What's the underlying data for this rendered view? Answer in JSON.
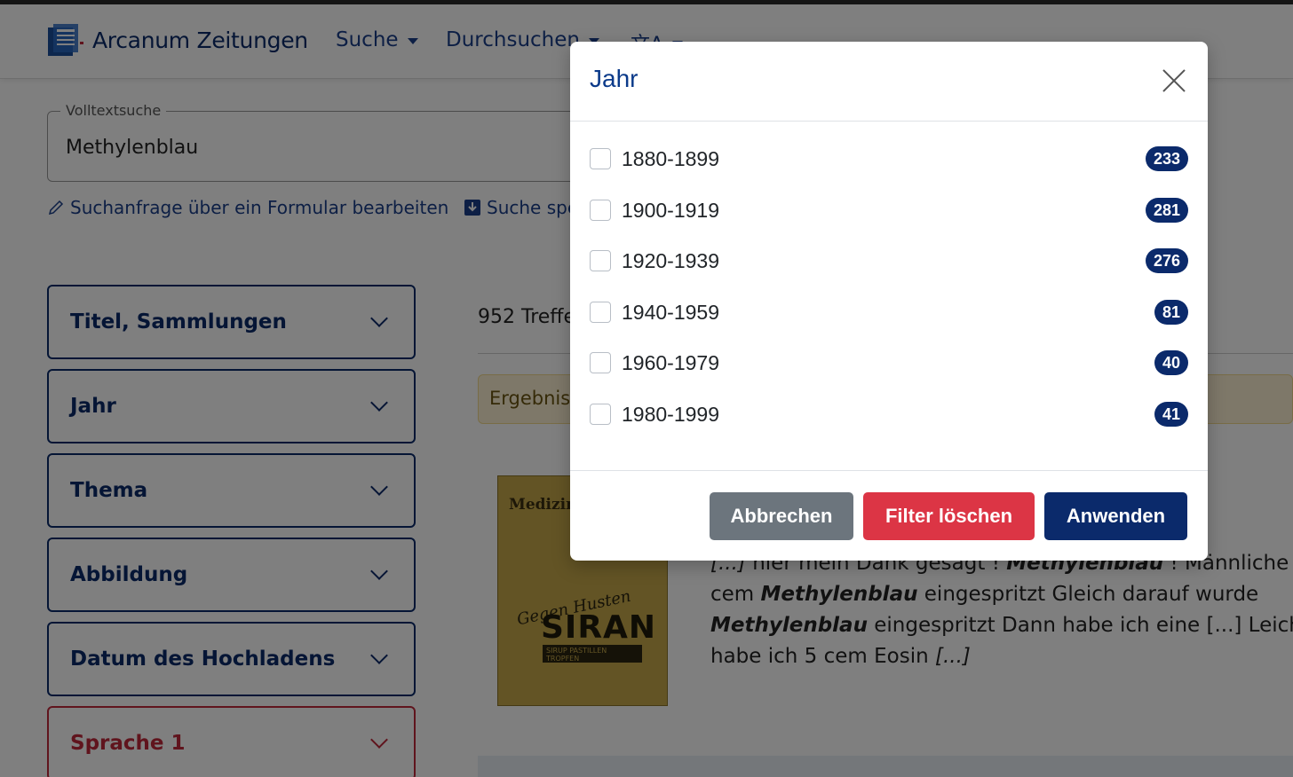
{
  "app": {
    "brand_prefix": "Arcanum",
    "brand_suffix": " Zeitungen"
  },
  "nav": {
    "search": "Suche",
    "browse": "Durchsuchen",
    "language_icon": "translate-icon"
  },
  "search": {
    "legend": "Volltextsuche",
    "value": "Methylenblau"
  },
  "links": {
    "edit_form": "Suchanfrage über ein Formular bearbeiten",
    "save_search": "Suche spe"
  },
  "facets": [
    {
      "label": "Titel, Sammlungen"
    },
    {
      "label": "Jahr"
    },
    {
      "label": "Thema"
    },
    {
      "label": "Abbildung"
    },
    {
      "label": "Datum des Hochladens"
    },
    {
      "label": "Sprache 1"
    }
  ],
  "results": {
    "hits": "952 Treffe",
    "note": "Ergebniss",
    "thumb_title": "Medizinisch",
    "thumb_script": "Gegen Husten",
    "thumb_brand": "SIRAN",
    "thumb_strip": "SIRUP PASTILLEN TROPFEN",
    "snippet": [
      {
        "pre": "[...] ",
        "mid": "hier mein Dank gesagt ! ",
        "bold": "Methylenblau",
        "post": " ! Männliche Le"
      },
      {
        "pre": "",
        "mid": "cem  ",
        "bold": "Methylenblau",
        "post": "  eingespritzt  Gleich  darauf  wurde"
      },
      {
        "pre": "",
        "mid": "",
        "bold": "Methylenblau",
        "post": " eingespritzt Dann habe ich eine [...] Leich"
      },
      {
        "pre": "",
        "mid": "habe ich 5 cem Eosin ",
        "bold": "",
        "post": "[...]"
      }
    ]
  },
  "modal": {
    "title": "Jahr",
    "options": [
      {
        "label": "1880-1899",
        "count": "233"
      },
      {
        "label": "1900-1919",
        "count": "281"
      },
      {
        "label": "1920-1939",
        "count": "276"
      },
      {
        "label": "1940-1959",
        "count": "81"
      },
      {
        "label": "1960-1979",
        "count": "40"
      },
      {
        "label": "1980-1999",
        "count": "41"
      }
    ],
    "cancel": "Abbrechen",
    "clear": "Filter löschen",
    "apply": "Anwenden"
  },
  "colors": {
    "primary": "#0b2a6b",
    "danger": "#dc3545",
    "secondary": "#6c757d",
    "warning_bg": "#fdf1d2"
  }
}
